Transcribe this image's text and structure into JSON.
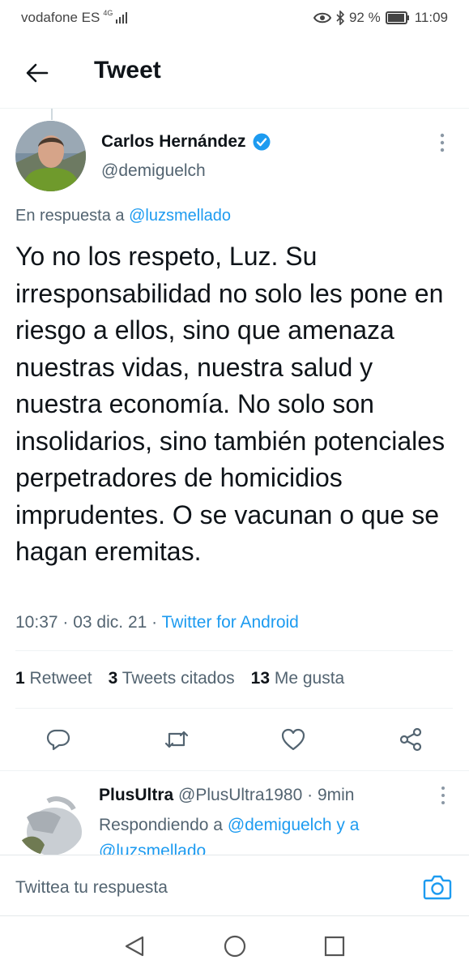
{
  "status_bar": {
    "carrier": "vodafone ES",
    "network": "4G",
    "battery": "92 %",
    "time": "11:09"
  },
  "header": {
    "title": "Tweet"
  },
  "tweet": {
    "author_name": "Carlos Hernández",
    "author_handle": "@demiguelch",
    "reply_prefix": "En respuesta a",
    "reply_target": "@luzsmellado",
    "text": "Yo no los respeto, Luz. Su irresponsabilidad no solo les pone en riesgo a ellos, sino que amenaza nuestras vidas, nuestra salud y nuestra economía. No solo son insolidarios, sino también potenciales perpetradores de homicidios imprudentes. O se vacunan o que se hagan eremitas.",
    "time": "10:37",
    "date": "03 dic. 21",
    "source": "Twitter for Android"
  },
  "stats": {
    "retweets_count": "1",
    "retweets_label": "Retweet",
    "quotes_count": "3",
    "quotes_label": "Tweets citados",
    "likes_count": "13",
    "likes_label": "Me gusta"
  },
  "reply": {
    "name": "PlusUltra",
    "handle": "@PlusUltra1980",
    "age": "9min",
    "responding_prefix": "Respondiendo a",
    "target1": "@demiguelch",
    "conjunction": "y a",
    "target2": "@luzsmellado"
  },
  "compose": {
    "placeholder": "Twittea tu respuesta"
  },
  "colors": {
    "accent": "#1d9bf0",
    "text": "#0f1419",
    "muted": "#536471"
  },
  "icons": {
    "back": "arrow-left-icon",
    "verified": "verified-badge-icon",
    "more": "more-vertical-icon",
    "reply": "reply-bubble-icon",
    "retweet": "retweet-icon",
    "like": "heart-icon",
    "share": "share-icon",
    "camera": "camera-icon"
  }
}
